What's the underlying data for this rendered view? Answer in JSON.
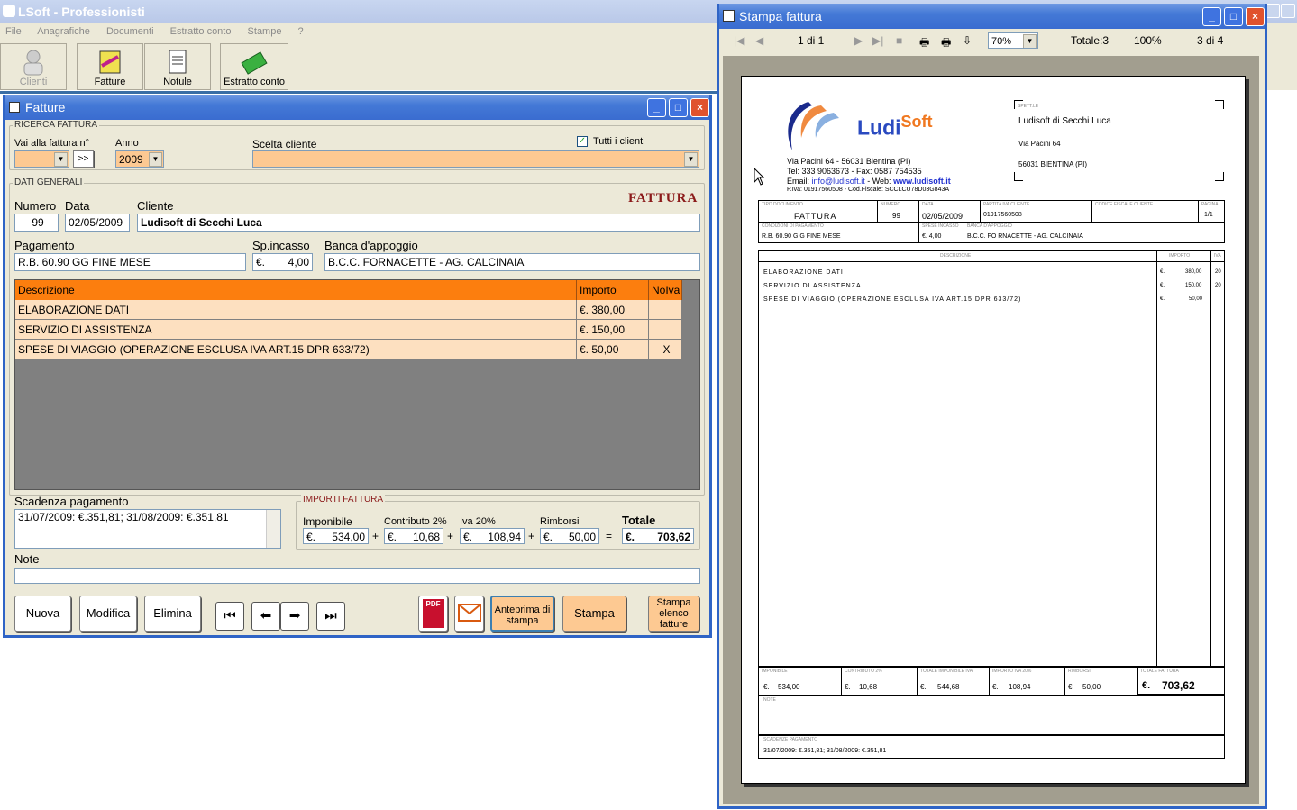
{
  "app": {
    "title": "LSoft - Professionisti",
    "menu": [
      "File",
      "Anagrafiche",
      "Documenti",
      "Estratto conto",
      "Stampe",
      "?"
    ],
    "toolbar": [
      "Clienti",
      "Fatture",
      "Notule",
      "Estratto conto"
    ]
  },
  "fatture": {
    "title": "Fatture",
    "ricerca": {
      "label": "RICERCA FATTURA",
      "vai_label": "Vai alla fattura n°",
      "vai_button": ">>",
      "anno_label": "Anno",
      "anno_value": "2009",
      "scelta_label": "Scelta cliente",
      "tutti_label": "Tutti i clienti"
    },
    "dati": {
      "label": "DATI GENERALI",
      "doc_type": "FATTURA",
      "numero_label": "Numero",
      "numero": "99",
      "data_label": "Data",
      "data": "02/05/2009",
      "cliente_label": "Cliente",
      "cliente": "Ludisoft di Secchi Luca",
      "pagamento_label": "Pagamento",
      "pagamento": "R.B. 60.90 GG FINE MESE",
      "sp_label": "Sp.incasso",
      "sp_cur": "€.",
      "sp_value": "4,00",
      "banca_label": "Banca d'appoggio",
      "banca": "B.C.C. FORNACETTE - AG. CALCINAIA"
    },
    "grid": {
      "headers": [
        "Descrizione",
        "Importo",
        "NoIva"
      ],
      "rows": [
        [
          "ELABORAZIONE DATI",
          "€. 380,00",
          ""
        ],
        [
          "SERVIZIO DI ASSISTENZA",
          "€. 150,00",
          ""
        ],
        [
          "SPESE DI VIAGGIO (OPERAZIONE ESCLUSA IVA ART.15 DPR 633/72)",
          "€. 50,00",
          "X"
        ]
      ]
    },
    "scadenza_label": "Scadenza pagamento",
    "scadenza": "31/07/2009: €.351,81; 31/08/2009: €.351,81",
    "importi": {
      "label": "IMPORTI FATTURA",
      "imponibile_label": "Imponibile",
      "imponibile": "534,00",
      "contributo_label": "Contributo 2%",
      "contributo": "10,68",
      "iva_label": "Iva 20%",
      "iva": "108,94",
      "rimborsi_label": "Rimborsi",
      "rimborsi": "50,00",
      "totale_label": "Totale",
      "totale": "703,62",
      "cur": "€.",
      "plus": "+",
      "eq": "="
    },
    "note_label": "Note",
    "buttons": {
      "nuova": "Nuova",
      "modifica": "Modifica",
      "elimina": "Elimina",
      "pdf": "PDF",
      "anteprima": "Anteprima di stampa",
      "stampa": "Stampa",
      "elenco": "Stampa elenco fatture"
    }
  },
  "stampa": {
    "title": "Stampa fattura",
    "page": "1 di 1",
    "zoom": "70%",
    "totale": "Totale:3",
    "pct": "100%",
    "pages": "3 di 4",
    "inv": {
      "logo_a": "Ludi",
      "logo_b": "Soft",
      "addr": "Via Pacini 64 - 56031 Bientina (PI)",
      "tel": "Tel: 333 9063673 - Fax: 0587 754535",
      "email_l": "Email:",
      "email": "info@ludisoft.it",
      "web_l": " - Web:",
      "web": "www.ludisoft.it",
      "piva": "P.Iva: 01917560508 - Cod.Fiscale: SCCLCU78D03G843A",
      "spett": "SPETT.LE",
      "c_name": "Ludisoft di Secchi Luca",
      "c_addr": "Via Pacini 64",
      "c_city": "56031  BIENTINA  (PI)",
      "h_tipo": "TIPO DOCUMENTO",
      "h_num": "NUMERO",
      "h_data": "DATA",
      "h_piva": "PARTITA IVA CLIENTE",
      "h_cf": "CODICE FISCALE CLIENTE",
      "h_pag": "PAGINA",
      "tipo": "FATTURA",
      "num": "99",
      "data": "02/05/2009",
      "piva_c": "01917560508",
      "pagina": "1/1",
      "h_cond": "CONDIZIONI DI PAGAMENTO",
      "h_spese": "SPESE INCASSO",
      "h_banca": "BANCA D'APPOGGIO",
      "cond": "R.B. 60.90 G G FINE MESE",
      "spese": "€.       4,00",
      "banca": "B.C.C. FO RNACETTE - AG. CALCINAIA",
      "h_desc": "DESCRIZIONE",
      "h_imp": "IMPORTO",
      "h_iva": "IVA",
      "rows": [
        [
          "ELABORAZIONE DATI",
          "€.",
          "380,00",
          "20"
        ],
        [
          "SERVIZIO DI ASSISTENZA",
          "€.",
          "150,00",
          "20"
        ],
        [
          "SPESE DI VIAGGIO (OPERAZIONE ESCLUSA IVA ART.15 DPR 633/72)",
          "€.",
          "50,00",
          ""
        ]
      ],
      "f_labels": [
        "IMPONIBILE",
        "CONTRIBUTO 2%",
        "TOTALE IMPONIBILE IVA",
        "IMPORTO IVA 20%",
        "RIMBORSI",
        "TOTALE FATTURA"
      ],
      "f_values": [
        "534,00",
        "10,68",
        "544,68",
        "108,94",
        "50,00",
        "703,62"
      ],
      "cur": "€.",
      "note": "NOTE",
      "scad_l": "SCADENZE PAGAMENTO",
      "scad": "31/07/2009: €.351,81; 31/08/2009: €.351,81"
    }
  }
}
